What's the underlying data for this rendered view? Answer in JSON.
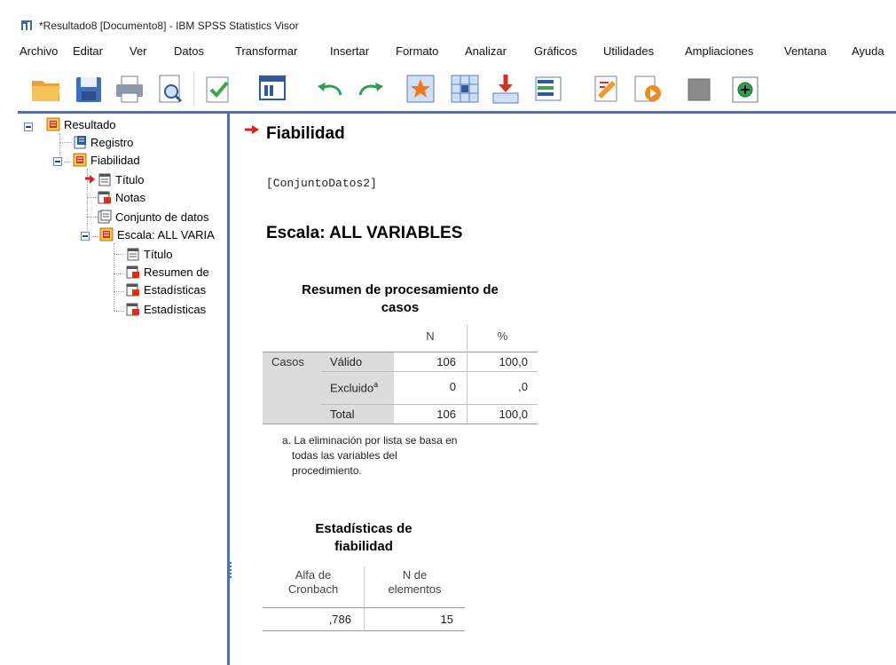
{
  "window": {
    "title": "*Resultado8 [Documento8] - IBM SPSS Statistics Visor"
  },
  "menu": [
    "Archivo",
    "Editar",
    "Ver",
    "Datos",
    "Transformar",
    "Insertar",
    "Formato",
    "Analizar",
    "Gráficos",
    "Utilidades",
    "Ampliaciones",
    "Ventana",
    "Ayuda"
  ],
  "toolbar": {
    "icons": [
      "open-folder-icon",
      "save-icon",
      "print-icon",
      "print-preview-icon",
      "export-icon",
      "recall-dialog-icon",
      "undo-icon",
      "redo-icon",
      "go-to-case-icon",
      "go-to-variable-icon",
      "insert-output-icon",
      "variables-icon",
      "designate-window-icon",
      "promote-icon",
      "disabled-icon",
      "add-icon"
    ]
  },
  "tree": {
    "root": "Resultado",
    "items": [
      "Registro",
      "Fiabilidad",
      "Título",
      "Notas",
      "Conjunto de datos",
      "Escala: ALL VARIA",
      "Título",
      "Resumen de",
      "Estadísticas",
      "Estadísticas"
    ]
  },
  "output": {
    "heading": "Fiabilidad",
    "dataset": "[ConjuntoDatos2]",
    "scale_heading": "Escala: ALL VARIABLES",
    "summary_table": {
      "title_line1": "Resumen de procesamiento de",
      "title_line2": "casos",
      "col_n": "N",
      "col_pct": "%",
      "row_group": "Casos",
      "rows": [
        {
          "label": "Válido",
          "sup": "",
          "n": "106",
          "pct": "100,0"
        },
        {
          "label": "Excluido",
          "sup": "a",
          "n": "0",
          "pct": ",0"
        },
        {
          "label": "Total",
          "sup": "",
          "n": "106",
          "pct": "100,0"
        }
      ],
      "footnote_line1": "a. La eliminación por lista se basa en",
      "footnote_line2": "todas las variables del",
      "footnote_line3": "procedimiento."
    },
    "reliability_table": {
      "title_line1": "Estadísticas de",
      "title_line2": "fiabilidad",
      "col1_line1": "Alfa de",
      "col1_line2": "Cronbach",
      "col2_line1": "N de",
      "col2_line2": "elementos",
      "alpha": ",786",
      "n_items": "15"
    }
  },
  "colors": {
    "accent_blue": "#4f6fb4",
    "shade_gray": "#dcdcdc",
    "arrow_red": "#e0201c"
  }
}
